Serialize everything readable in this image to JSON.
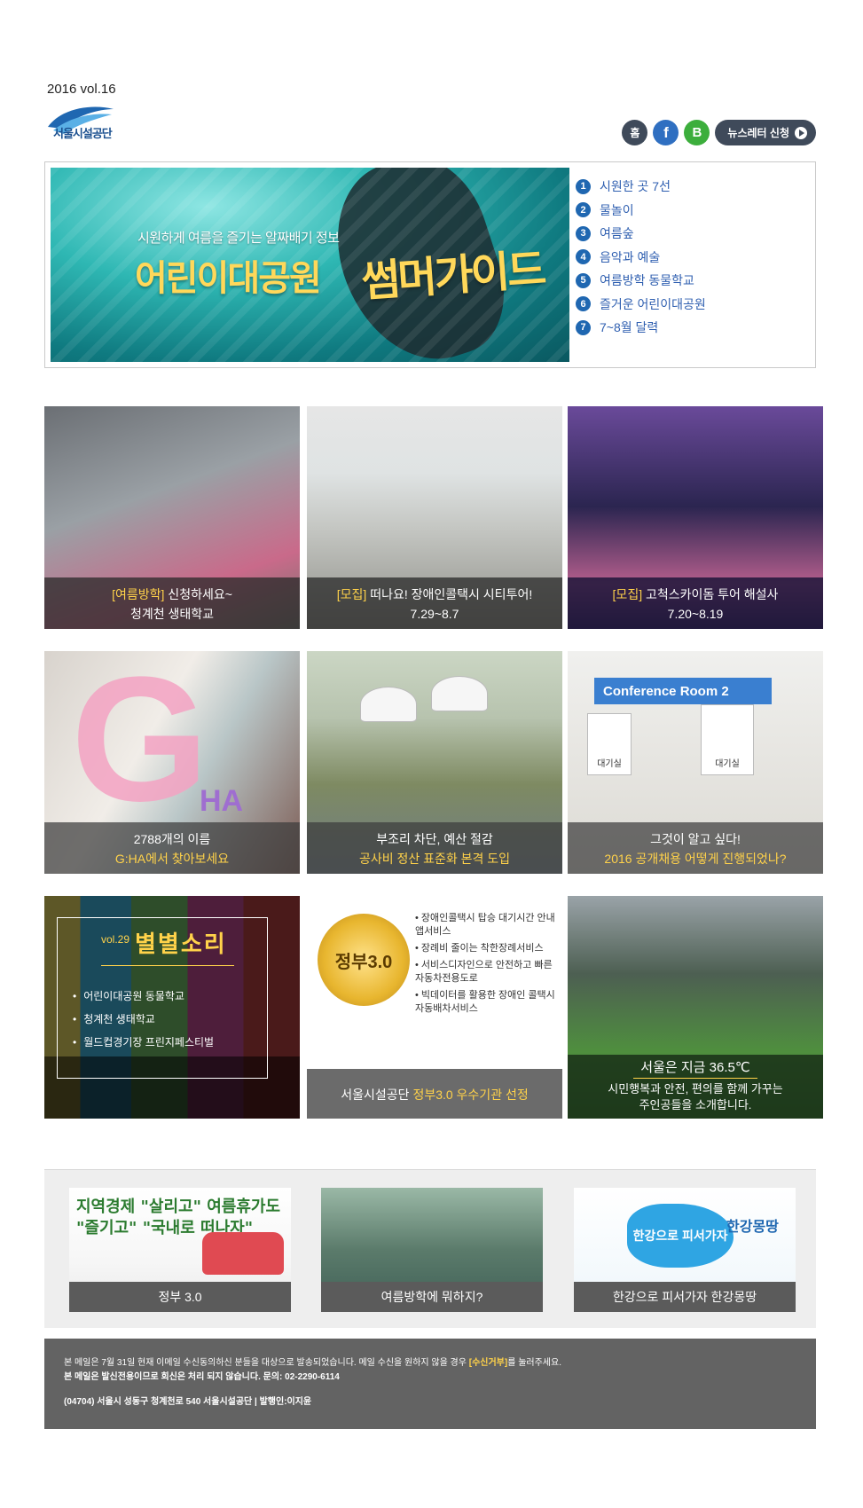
{
  "header": {
    "issue": "2016 vol.16",
    "logo_text": "서울시설공단",
    "home_label": "홈",
    "facebook_label": "f",
    "blog_label": "B",
    "newsletter_label": "뉴스레터 신청"
  },
  "hero": {
    "subtitle": "시원하게 여름을 즐기는 알짜배기 정보",
    "title_main": "어린이대공원",
    "title_script": "썸머가이드",
    "items": [
      {
        "num": "1",
        "label": "시원한 곳 7선"
      },
      {
        "num": "2",
        "label": "물놀이"
      },
      {
        "num": "3",
        "label": "여름숲"
      },
      {
        "num": "4",
        "label": "음악과 예술"
      },
      {
        "num": "5",
        "label": "여름방학 동물학교"
      },
      {
        "num": "6",
        "label": "즐거운 어린이대공원"
      },
      {
        "num": "7",
        "label": "7~8월 달력"
      }
    ]
  },
  "tiles": {
    "t1": {
      "tag": "[여름방학]",
      "line1": " 신청하세요~",
      "line2": "청계천 생태학교"
    },
    "t2": {
      "tag": "[모집]",
      "line1": " 떠나요! 장애인콜택시 시티투어!",
      "line2": "7.29~8.7"
    },
    "t3": {
      "tag": "[모집]",
      "line1": " 고척스카이돔 투어 해설사",
      "line2": "7.20~8.19"
    },
    "t4": {
      "line1": "2788개의 이름",
      "line2": "G:HA에서 찾아보세요",
      "big_letter": "G",
      "ha": "HA"
    },
    "t5": {
      "line1": "부조리 차단, 예산 절감",
      "line2": "공사비 정산 표준화 본격 도입"
    },
    "t6": {
      "board": "Conference Room 2",
      "sign": "대기실",
      "line1": "그것이 알고 싶다!",
      "line2": "2016 공개채용 어떻게 진행되었나?"
    },
    "t7": {
      "vol": "vol.29",
      "title": "별별소리",
      "items": [
        "어린이대공원 동물학교",
        "청계천 생태학교",
        "월드컵경기장 프린지페스티벌"
      ]
    },
    "t8": {
      "seal": "정부3.0",
      "items": [
        "장애인콜택시 탑승 대기시간 안내 앱서비스",
        "장례비 줄이는 착한장례서비스",
        "서비스디자인으로 안전하고 빠른 자동차전용도로",
        "빅데이터를 활용한 장애인 콜택시 자동배차서비스"
      ],
      "caption_a": "서울시설공단 ",
      "caption_b": "정부3.0 우수기관 선정"
    },
    "t9": {
      "line1": "서울은 지금 36.5℃",
      "line2": "시민행복과 안전, 편의를 함께 가꾸는",
      "line3": "주인공들을 소개합니다."
    }
  },
  "bottom": [
    {
      "caption": "정부 3.0",
      "art": "지역경제 \"살리고\" 여름휴가도 \"즐기고\" \"국내로 떠나자\""
    },
    {
      "caption": "여름방학에 뭐하지?"
    },
    {
      "caption": "한강으로 피서가자 한강몽땅",
      "art": "한강으로 피서가자",
      "logo": "한강몽땅"
    }
  ],
  "footer": {
    "line1a": "본 메일은 7월 31일 현재 이메일 수신동의하신 분들을 대상으로 발송되었습니다. 메일 수신을 원하지 않을 경우 ",
    "line1b": "[수신거부]",
    "line1c": "를 눌러주세요.",
    "line2": "본 메일은 발신전용이므로 회신은 처리 되지 않습니다. 문의: 02-2290-6114",
    "line3": "(04704) 서울시 성동구 청계천로 540 서울시설공단 | 발행인:이지윤"
  }
}
